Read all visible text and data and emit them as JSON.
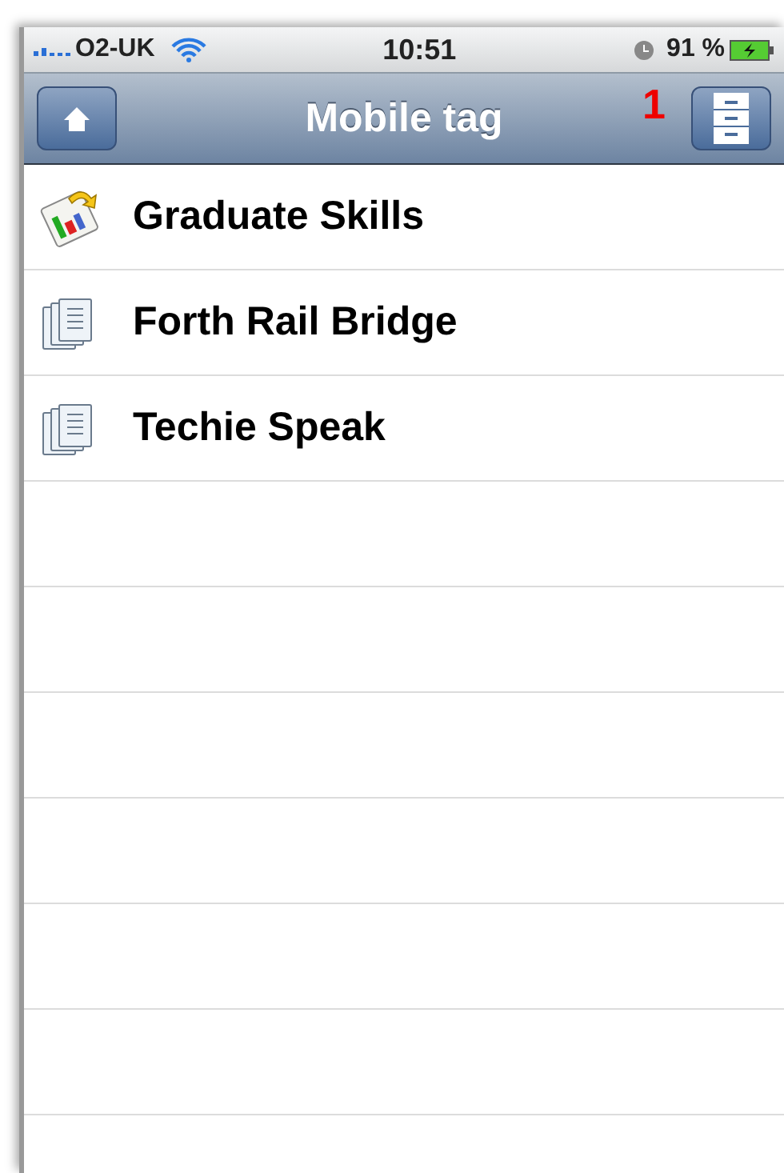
{
  "status_bar": {
    "carrier": "O2-UK",
    "time": "10:51",
    "battery": "91 %"
  },
  "nav_bar": {
    "title": "Mobile tag",
    "annotation": "1"
  },
  "items": [
    {
      "label": "Graduate Skills",
      "kind": "quiz"
    },
    {
      "label": "Forth Rail Bridge",
      "kind": "document"
    },
    {
      "label": "Techie Speak",
      "kind": "document"
    }
  ]
}
